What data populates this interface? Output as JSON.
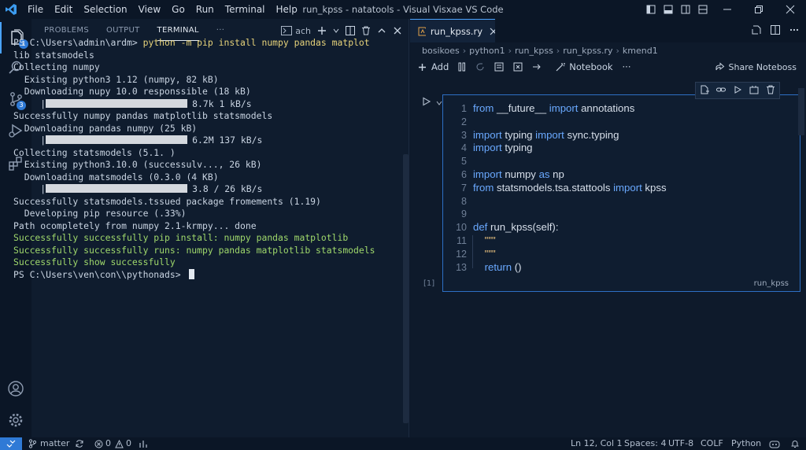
{
  "window": {
    "title": "run_kpss - natatools - Visual Visxae VS Code",
    "menu": [
      "File",
      "Edit",
      "Selection",
      "View",
      "Go",
      "Run",
      "Terminal",
      "Help"
    ]
  },
  "activity_bar": {
    "explorer_badge": "1",
    "source_control_badge": "3"
  },
  "panel": {
    "tabs": [
      "PROBLEMS",
      "OUTPUT",
      "TERMINAL"
    ],
    "active_tab": "TERMINAL",
    "more": "···",
    "terminal_label": "ach",
    "terminal_lines": [
      {
        "prompt": "PS C:\\Users\\admin\\ardm> ",
        "cmd": "python -m pip install numpy pandas matplot"
      },
      {
        "text": "lib statsmodels"
      },
      {
        "text": "Collecting numpy"
      },
      {
        "text": "  Existing python3 1.12 (numpy, 82 kB)"
      },
      {
        "text": "  Downloading nupy 10.0 responssible (18 kB)"
      },
      {
        "bar_indent": "     ",
        "bar_text": "8.7k 1 kB/s"
      },
      {
        "text": "Successfully numpy pandas matplotlib statsmodels"
      },
      {
        "text": "  Downloading pandas numpy (25 kB)"
      },
      {
        "bar_indent": "     ",
        "bar_text": "6.2M 137 kB/s"
      },
      {
        "text": "Collecting statsmodels (5.1. )"
      },
      {
        "text": "  Existing python3.10.0 (successulv..., 26 kB)"
      },
      {
        "text": "  Downloading matsmodels (0.3.0 (4 KB)"
      },
      {
        "bar_indent": "     ",
        "bar_text": "3.8 / 26 kB/s"
      },
      {
        "text": "Successfully statsmodels.tssued package fromements (1.19)"
      },
      {
        "text": "  Developing pip resource (.33%)"
      },
      {
        "text": "Path ocompletely from numpy 2.1-krmpy... done"
      },
      {
        "ok": "Successfully successfully pip install: numpy pandas matplotlib"
      },
      {
        "ok": "Successfully successfully runs: numpy pandas matplotlib statsmodels"
      },
      {
        "ok": "Successfully show successfully"
      },
      {
        "prompt": "PS C:\\Users\\ven\\con\\\\pythonads> ",
        "cursor": true
      }
    ]
  },
  "editor": {
    "tab_label": "run_kpss.ry",
    "breadcrumb": [
      "bosikoes",
      "python1",
      "run_kpss",
      "run_kpss.ry",
      "kmend1"
    ],
    "toolbar": {
      "add_label": "Add",
      "notebook_label": "Notebook",
      "more": "···",
      "share_label": "Share Noteboss"
    },
    "cell": {
      "exec_count": "[1]",
      "language": "run_kpss",
      "lines": [
        {
          "n": "1",
          "parts": [
            [
              "kw",
              "from "
            ],
            [
              "tx",
              "__future__ "
            ],
            [
              "kw",
              "import "
            ],
            [
              "tx",
              "annotations"
            ]
          ]
        },
        {
          "n": "2",
          "parts": []
        },
        {
          "n": "3",
          "parts": [
            [
              "kw",
              "import "
            ],
            [
              "tx",
              "typing "
            ],
            [
              "kw",
              "import "
            ],
            [
              "tx",
              "sync.typing"
            ]
          ]
        },
        {
          "n": "4",
          "parts": [
            [
              "kw",
              "import "
            ],
            [
              "tx",
              "typing"
            ]
          ]
        },
        {
          "n": "5",
          "parts": []
        },
        {
          "n": "6",
          "parts": [
            [
              "kw",
              "import "
            ],
            [
              "tx",
              "numpy "
            ],
            [
              "kw",
              "as "
            ],
            [
              "tx",
              "np"
            ]
          ]
        },
        {
          "n": "7",
          "parts": [
            [
              "kw",
              "from "
            ],
            [
              "tx",
              "statsmodels.tsa.stattools "
            ],
            [
              "kw",
              "import "
            ],
            [
              "tx",
              "kpss"
            ]
          ]
        },
        {
          "n": "8",
          "parts": []
        },
        {
          "n": "9",
          "parts": []
        },
        {
          "n": "10",
          "parts": [
            [
              "kw",
              "def "
            ],
            [
              "tx",
              "run_kpss(self):"
            ]
          ]
        },
        {
          "n": "11",
          "parts": [
            [
              "st",
              "    \"\"\""
            ]
          ]
        },
        {
          "n": "12",
          "parts": [
            [
              "st",
              "    \"\"\""
            ]
          ]
        },
        {
          "n": "13",
          "parts": [
            [
              "kw",
              "    return "
            ],
            [
              "tx",
              "()"
            ]
          ]
        }
      ]
    }
  },
  "status_bar": {
    "branch": "matter",
    "errors": "0",
    "warnings": "0",
    "position": "Ln 12, Col 1",
    "spaces": "Spaces: 4",
    "encoding": "UTF-8",
    "eol": "COLF",
    "language": "Python"
  },
  "colors": {
    "accent": "#2f7ad6",
    "background": "#0e1a2b",
    "success_text": "#9fd86b",
    "keyword": "#6aa9ff"
  }
}
